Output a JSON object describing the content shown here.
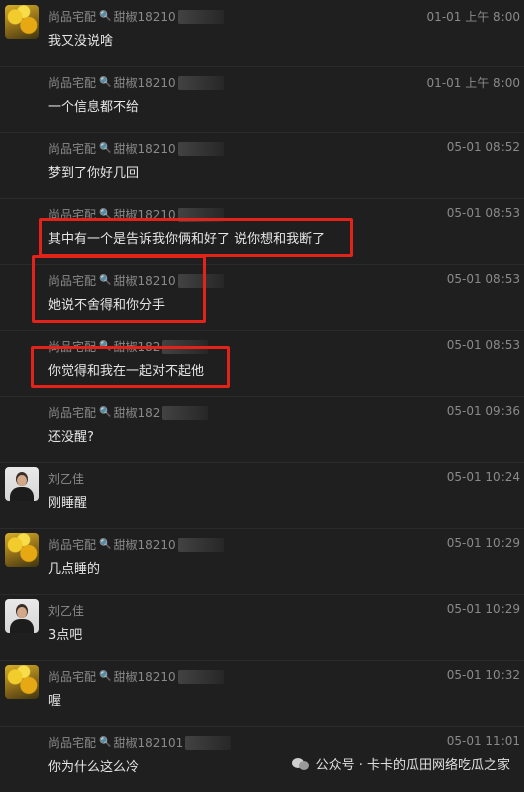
{
  "messages": [
    {
      "sender": "尚品宅配",
      "sender_suffix": "甜椒18210",
      "time": "01-01 上午 8:00",
      "text": "我又没说啥",
      "avatar": "autumn"
    },
    {
      "sender": "尚品宅配",
      "sender_suffix": "甜椒18210",
      "time": "01-01 上午 8:00",
      "text": "一个信息都不给",
      "avatar": "none"
    },
    {
      "sender": "尚品宅配",
      "sender_suffix": "甜椒18210",
      "time": "05-01 08:52",
      "text": "梦到了你好几回",
      "avatar": "none"
    },
    {
      "sender": "尚品宅配",
      "sender_suffix": "甜椒18210",
      "time": "05-01 08:53",
      "text": "其中有一个是告诉我你俩和好了 说你想和我断了",
      "avatar": "none"
    },
    {
      "sender": "尚品宅配",
      "sender_suffix": "甜椒18210",
      "time": "05-01 08:53",
      "text": "她说不舍得和你分手",
      "avatar": "none"
    },
    {
      "sender": "尚品宅配",
      "sender_suffix": "甜椒182",
      "time": "05-01 08:53",
      "text": "你觉得和我在一起对不起他",
      "avatar": "none"
    },
    {
      "sender": "尚品宅配",
      "sender_suffix": "甜椒182",
      "time": "05-01 09:36",
      "text": "还没醒?",
      "avatar": "none"
    },
    {
      "sender": "刘乙佳",
      "sender_suffix": "",
      "time": "05-01 10:24",
      "text": "刚睡醒",
      "avatar": "person"
    },
    {
      "sender": "尚品宅配",
      "sender_suffix": "甜椒18210",
      "time": "05-01 10:29",
      "text": "几点睡的",
      "avatar": "autumn"
    },
    {
      "sender": "刘乙佳",
      "sender_suffix": "",
      "time": "05-01 10:29",
      "text": "3点吧",
      "avatar": "person"
    },
    {
      "sender": "尚品宅配",
      "sender_suffix": "甜椒18210",
      "time": "05-01 10:32",
      "text": "喔",
      "avatar": "autumn"
    },
    {
      "sender": "尚品宅配",
      "sender_suffix": "甜椒182101",
      "time": "05-01 11:01",
      "text": "你为什么这么冷",
      "avatar": "none"
    }
  ],
  "watermark": {
    "text": "公众号 · 卡卡的瓜田网络吃瓜之家",
    "icon": "wechat-icon"
  },
  "colors": {
    "background": "#1f1f1f",
    "highlight": "#e3231a",
    "text": "#e6e6e6",
    "meta": "#8a8a8a"
  }
}
